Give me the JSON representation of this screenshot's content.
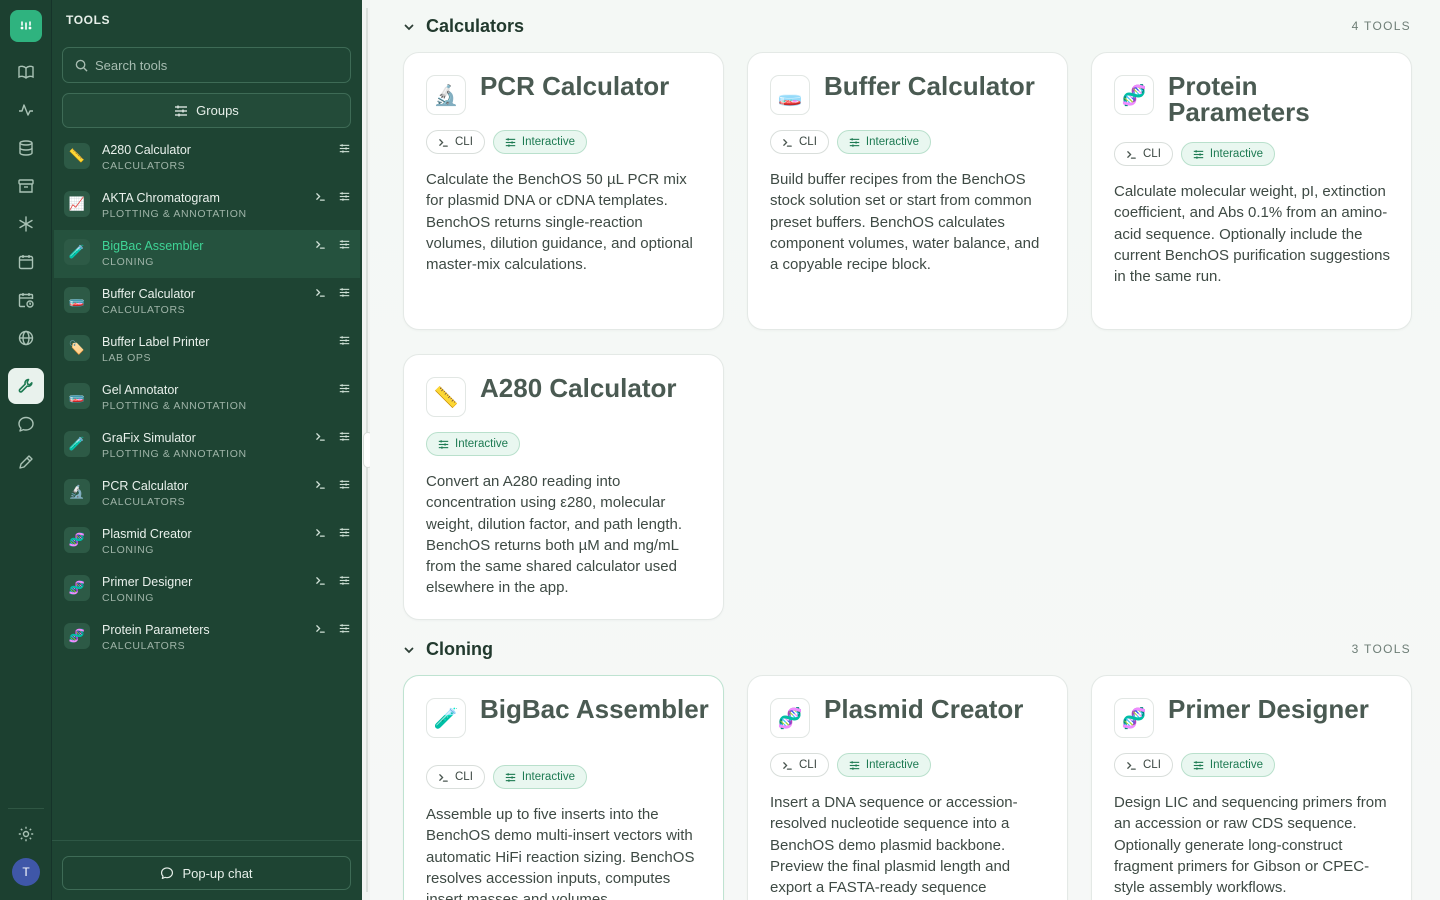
{
  "sidebar": {
    "title": "TOOLS",
    "search_placeholder": "Search tools",
    "groups_label": "Groups",
    "popup_label": "Pop-up chat",
    "avatar_initial": "T",
    "tools": [
      {
        "emoji": "📏",
        "name": "A280 Calculator",
        "category": "CALCULATORS",
        "cli": false,
        "interactive": true,
        "active": false
      },
      {
        "emoji": "📈",
        "name": "AKTA Chromatogram",
        "category": "PLOTTING & ANNOTATION",
        "cli": true,
        "interactive": true,
        "active": false
      },
      {
        "emoji": "🧪",
        "name": "BigBac Assembler",
        "category": "CLONING",
        "cli": true,
        "interactive": true,
        "active": true
      },
      {
        "emoji": "🧫",
        "name": "Buffer Calculator",
        "category": "CALCULATORS",
        "cli": true,
        "interactive": true,
        "active": false
      },
      {
        "emoji": "🏷️",
        "name": "Buffer Label Printer",
        "category": "LAB OPS",
        "cli": false,
        "interactive": true,
        "active": false
      },
      {
        "emoji": "🧫",
        "name": "Gel Annotator",
        "category": "PLOTTING & ANNOTATION",
        "cli": false,
        "interactive": true,
        "active": false
      },
      {
        "emoji": "🧪",
        "name": "GraFix Simulator",
        "category": "PLOTTING & ANNOTATION",
        "cli": true,
        "interactive": true,
        "active": false
      },
      {
        "emoji": "🔬",
        "name": "PCR Calculator",
        "category": "CALCULATORS",
        "cli": true,
        "interactive": true,
        "active": false
      },
      {
        "emoji": "🧬",
        "name": "Plasmid Creator",
        "category": "CLONING",
        "cli": true,
        "interactive": true,
        "active": false
      },
      {
        "emoji": "🧬",
        "name": "Primer Designer",
        "category": "CLONING",
        "cli": true,
        "interactive": true,
        "active": false
      },
      {
        "emoji": "🧬",
        "name": "Protein Parameters",
        "category": "CALCULATORS",
        "cli": true,
        "interactive": true,
        "active": false
      }
    ]
  },
  "sections": {
    "calculators": {
      "title": "Calculators",
      "count": "4 TOOLS"
    },
    "cloning": {
      "title": "Cloning",
      "count": "3 TOOLS"
    }
  },
  "badges": {
    "cli": "CLI",
    "interactive": "Interactive"
  },
  "cards": {
    "pcr": {
      "emoji": "🔬",
      "title": "PCR Calculator",
      "desc": "Calculate the BenchOS 50 µL PCR mix for plasmid DNA or cDNA templates. BenchOS returns single-reaction volumes, dilution guidance, and optional master-mix calculations."
    },
    "buffer": {
      "emoji": "🧫",
      "title": "Buffer Calculator",
      "desc": "Build buffer recipes from the BenchOS stock solution set or start from common preset buffers. BenchOS calculates component volumes, water balance, and a copyable recipe block."
    },
    "protein": {
      "emoji": "🧬",
      "title": "Protein Parameters",
      "desc": "Calculate molecular weight, pI, extinction coefficient, and Abs 0.1% from an amino-acid sequence. Optionally include the current BenchOS purification suggestions in the same run."
    },
    "a280": {
      "emoji": "📏",
      "title": "A280 Calculator",
      "desc": "Convert an A280 reading into concentration using ε280, molecular weight, dilution factor, and path length. BenchOS returns both µM and mg/mL from the same shared calculator used elsewhere in the app."
    },
    "bigbac": {
      "emoji": "🧪",
      "title": "BigBac Assembler",
      "desc": "Assemble up to five inserts into the BenchOS demo multi-insert vectors with automatic HiFi reaction sizing. BenchOS resolves accession inputs, computes insert masses and volumes"
    },
    "plasmid": {
      "emoji": "🧬",
      "title": "Plasmid Creator",
      "desc": "Insert a DNA sequence or accession-resolved nucleotide sequence into a BenchOS demo plasmid backbone. Preview the final plasmid length and export a FASTA-ready sequence"
    },
    "primer": {
      "emoji": "🧬",
      "title": "Primer Designer",
      "desc": "Design LIC and sequencing primers from an accession or raw CDS sequence. Optionally generate long-construct fragment primers for Gibson or CPEC-style assembly workflows."
    }
  }
}
